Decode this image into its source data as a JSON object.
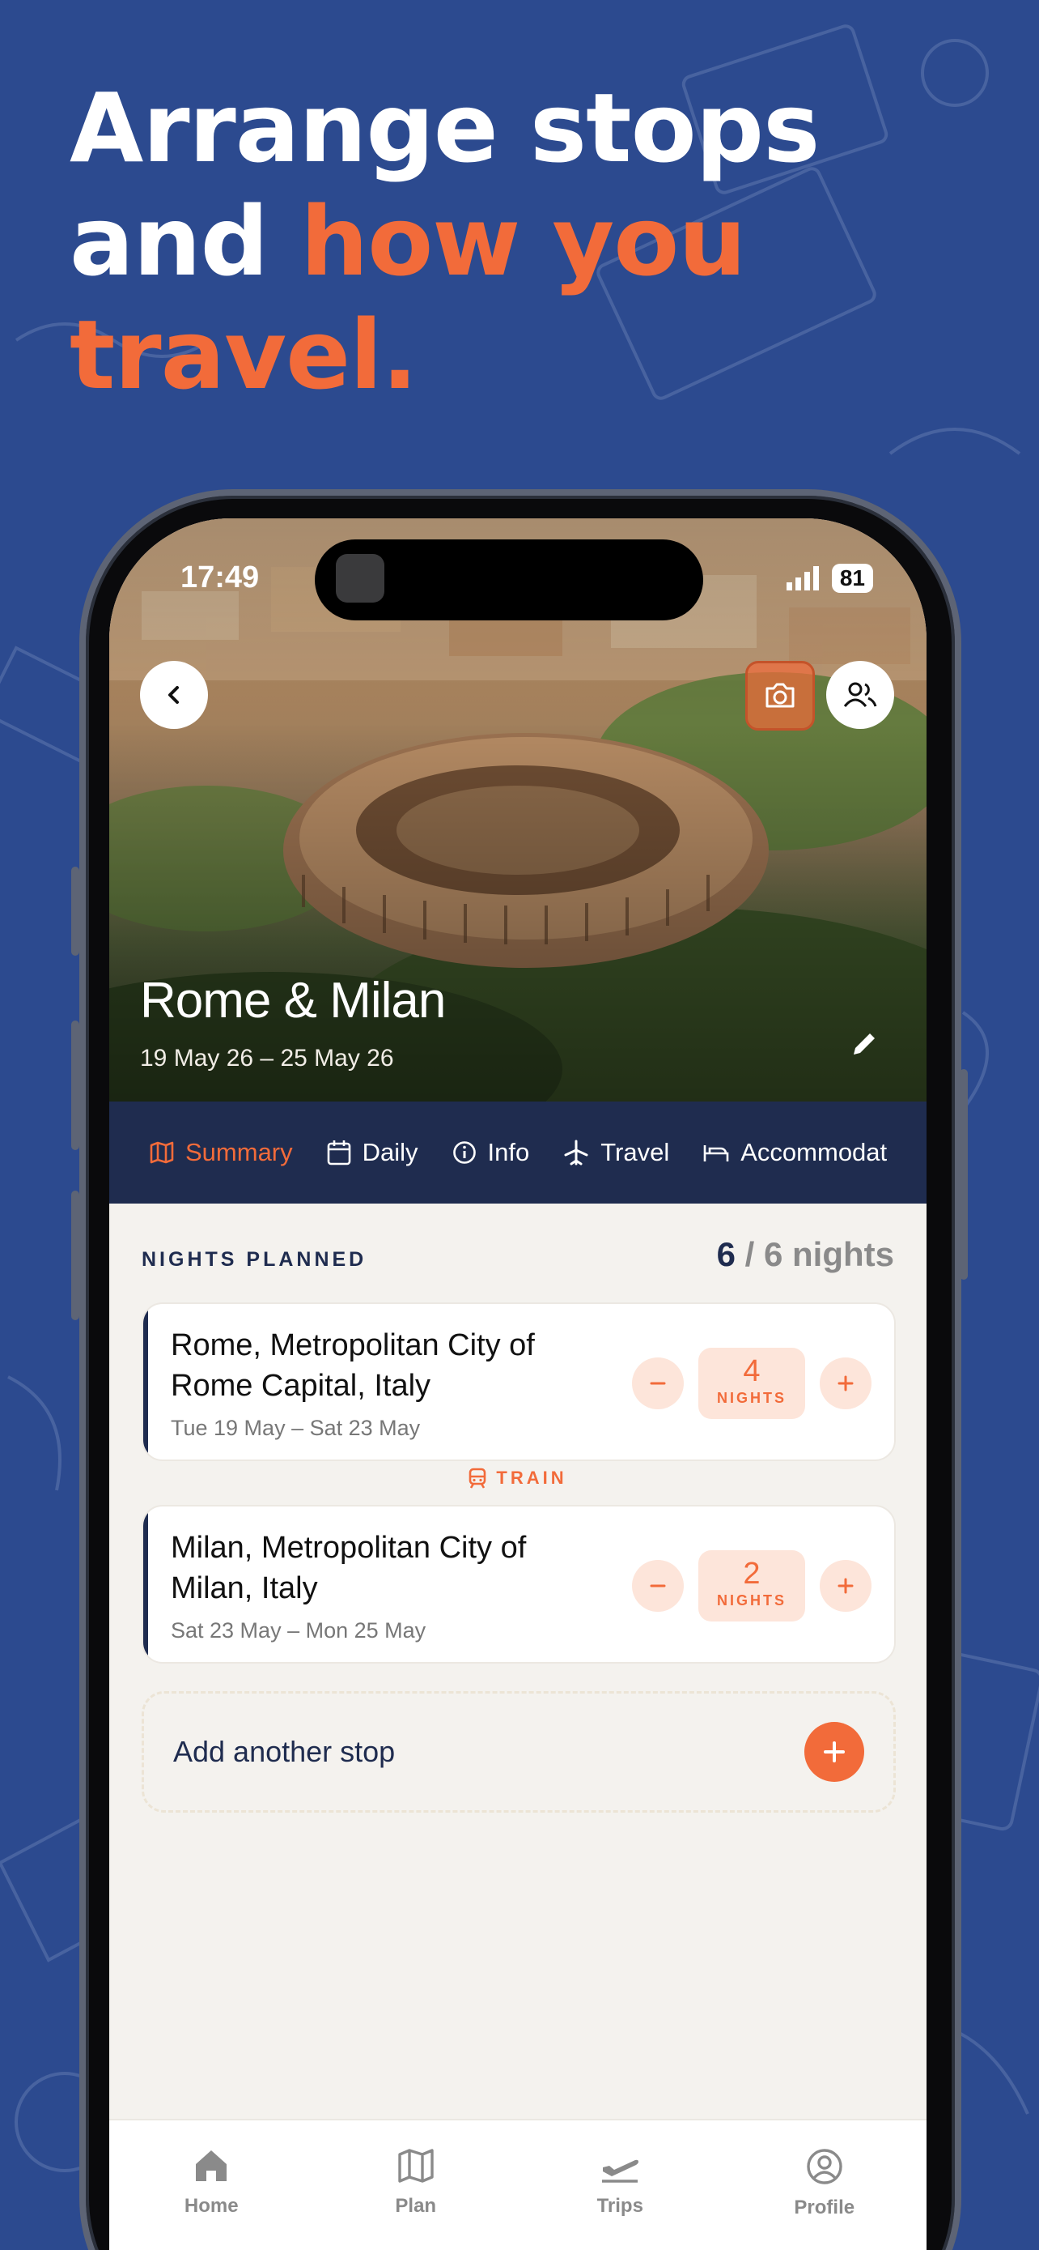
{
  "headline": {
    "line1": "Arrange stops",
    "line2_plain": "and ",
    "line2_accent": "how you",
    "line3_accent": "travel."
  },
  "colors": {
    "background": "#2c4a8f",
    "accent": "#f26b3a",
    "navy": "#1f2c4f"
  },
  "status_bar": {
    "time": "17:49",
    "battery": "81"
  },
  "trip": {
    "title": "Rome & Milan",
    "dates": "19 May 26 – 25 May 26"
  },
  "tabs": [
    {
      "label": "Summary",
      "icon": "map-icon",
      "active": true
    },
    {
      "label": "Daily",
      "icon": "calendar-icon",
      "active": false
    },
    {
      "label": "Info",
      "icon": "info-icon",
      "active": false
    },
    {
      "label": "Travel",
      "icon": "plane-icon",
      "active": false
    },
    {
      "label": "Accommodat",
      "icon": "bed-icon",
      "active": false
    }
  ],
  "nights": {
    "label": "NIGHTS PLANNED",
    "planned": "6",
    "separator_total": " / 6 nights"
  },
  "stops": [
    {
      "name": "Rome, Metropolitan City of Rome Capital, Italy",
      "dates": "Tue 19 May – Sat 23 May",
      "nights": "4",
      "nights_label": "NIGHTS"
    },
    {
      "name": "Milan, Metropolitan City of Milan, Italy",
      "dates": "Sat 23 May – Mon 25 May",
      "nights": "2",
      "nights_label": "NIGHTS"
    }
  ],
  "connector": {
    "mode": "TRAIN",
    "icon": "train-icon"
  },
  "add_stop": {
    "label": "Add another stop"
  },
  "bottom_nav": [
    {
      "label": "Home",
      "icon": "home-icon"
    },
    {
      "label": "Plan",
      "icon": "map-icon"
    },
    {
      "label": "Trips",
      "icon": "plane-departure-icon"
    },
    {
      "label": "Profile",
      "icon": "user-circle-icon"
    }
  ]
}
